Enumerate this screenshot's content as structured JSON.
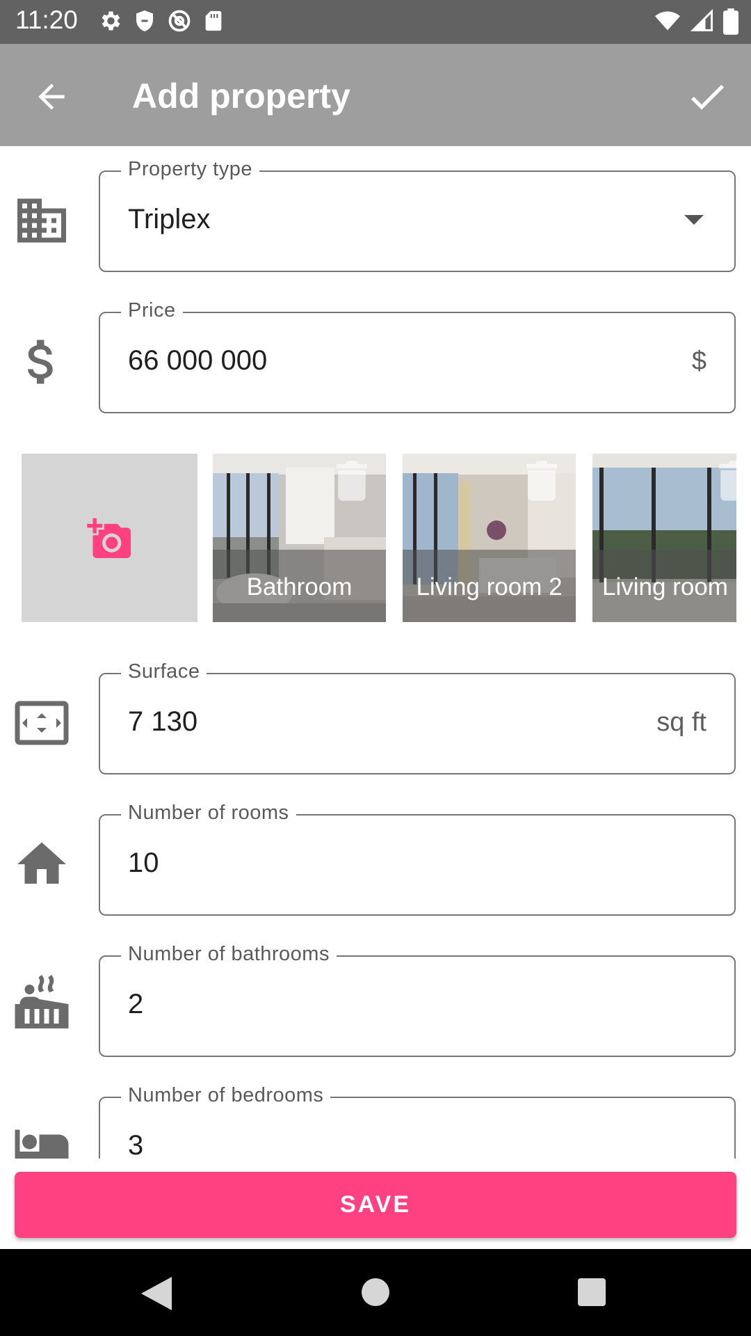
{
  "status_bar": {
    "time": "11:20",
    "left_icons": [
      "gear-icon",
      "shield-icon",
      "at-sign-icon",
      "sd-card-icon"
    ],
    "right_icons": [
      "wifi-icon",
      "signal-icon",
      "battery-icon"
    ]
  },
  "app_bar": {
    "title": "Add property",
    "back_icon": "arrow-left-icon",
    "confirm_icon": "check-icon"
  },
  "form": {
    "property_type": {
      "label": "Property type",
      "value": "Triplex",
      "icon": "building-icon"
    },
    "price": {
      "label": "Price",
      "value": "66 000 000",
      "suffix": "$",
      "icon": "dollar-icon"
    },
    "surface": {
      "label": "Surface",
      "value": "7 130",
      "suffix": "sq ft",
      "icon": "aspect-ratio-icon"
    },
    "rooms": {
      "label": "Number of rooms",
      "value": "10",
      "icon": "home-icon"
    },
    "bathrooms": {
      "label": "Number of bathrooms",
      "value": "2",
      "icon": "hot-tub-icon"
    },
    "bedrooms": {
      "label": "Number of bedrooms",
      "value": "3",
      "icon": "bed-icon"
    }
  },
  "photos": {
    "add_icon": "add-a-photo-icon",
    "items": [
      {
        "caption": "Bathroom"
      },
      {
        "caption": "Living room 2"
      },
      {
        "caption": "Living room"
      }
    ]
  },
  "save_button": {
    "label": "SAVE"
  },
  "colors": {
    "accent": "#ff4081",
    "app_bar": "#9e9e9e",
    "status_bar": "#626262",
    "nav_bar": "#000000",
    "icon_gray": "#6b6b6b"
  },
  "nav_bar": {
    "icons": [
      "back-triangle-icon",
      "home-circle-icon",
      "recents-square-icon"
    ]
  }
}
